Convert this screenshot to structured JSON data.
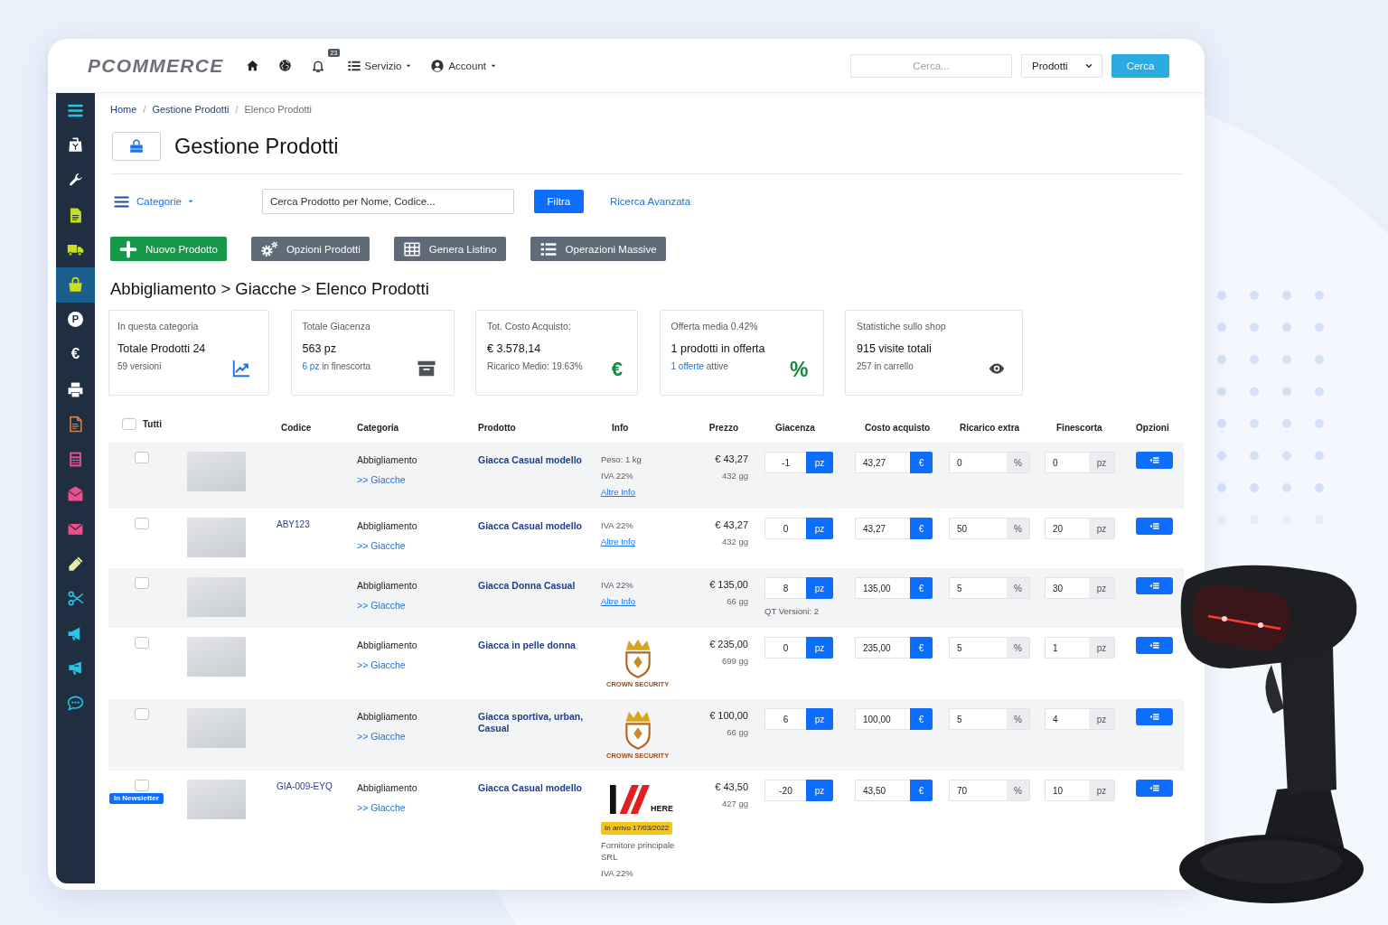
{
  "header": {
    "logo": "PCOMMERCE",
    "notification_count": "23",
    "menus": [
      {
        "label": "Servizio"
      },
      {
        "label": "Account"
      }
    ],
    "search": {
      "placeholder": "Cerca..."
    },
    "scope_select": {
      "value": "Prodotti"
    },
    "search_button": "Cerca"
  },
  "sidebar": {
    "items": [
      {
        "kind": "icon",
        "selected": false
      },
      {
        "kind": "icon",
        "selected": false
      },
      {
        "kind": "icon",
        "selected": false
      },
      {
        "kind": "icon",
        "selected": false
      },
      {
        "kind": "icon",
        "selected": false
      },
      {
        "kind": "icon",
        "selected": true
      },
      {
        "kind": "circle",
        "glyph": "P",
        "selected": false
      },
      {
        "kind": "glyph",
        "glyph": "€",
        "selected": false
      },
      {
        "kind": "icon",
        "selected": false
      },
      {
        "kind": "icon",
        "selected": false
      },
      {
        "kind": "icon",
        "selected": false
      },
      {
        "kind": "icon",
        "selected": false
      },
      {
        "kind": "icon",
        "selected": false
      },
      {
        "kind": "icon",
        "selected": false
      },
      {
        "kind": "icon",
        "selected": false
      },
      {
        "kind": "icon",
        "selected": false
      },
      {
        "kind": "icon",
        "selected": false
      },
      {
        "kind": "icon",
        "selected": false
      }
    ]
  },
  "breadcrumb": [
    {
      "kind": "link",
      "text": "Home"
    },
    {
      "kind": "separator",
      "text": "/"
    },
    {
      "kind": "link",
      "text": "Gestione Prodotti"
    },
    {
      "kind": "separator",
      "text": "/"
    },
    {
      "kind": "current",
      "text": "Elenco Prodotti"
    }
  ],
  "page_title": "Gestione Prodotti",
  "filter_bar": {
    "categories": "Categorie",
    "search": {
      "placeholder": "Cerca Prodotto per Nome, Codice..."
    },
    "filter_button": "Filtra",
    "advanced_search": "Ricerca Avanzata"
  },
  "actions": [
    {
      "kind": "primary",
      "label": "Nuovo Prodotto"
    },
    {
      "kind": "secondary",
      "label": "Opzioni Prodotti"
    },
    {
      "kind": "secondary",
      "label": "Genera Listino"
    },
    {
      "kind": "secondary",
      "label": "Operazioni Massive"
    }
  ],
  "category_path": "Abbigliamento > Giacche > Elenco Prodotti",
  "stats": [
    {
      "label": "In questa categoria",
      "value": "Totale Prodotti 24",
      "note": {
        "text": "59 versioni"
      }
    },
    {
      "label": "Totale Giacenza",
      "value": "563 pz",
      "note": {
        "link": "6 pz",
        "text": "in finescorta"
      }
    },
    {
      "label": "Tot. Costo Acquisto:",
      "value": "€ 3.578,14",
      "note": {
        "text": "Ricarico Medio: 19.63%"
      },
      "glyph": "€"
    },
    {
      "label": "Offerta media 0.42%",
      "value": "1 prodotti in offerta",
      "note": {
        "link": "1 offerte",
        "text": "attive"
      },
      "glyph": "%"
    },
    {
      "label": "Statistiche sullo shop",
      "value": "915 visite totali",
      "note": {
        "text": "257 in carrello"
      }
    }
  ],
  "table": {
    "select_all": {
      "label": "Tutti",
      "checked": false
    },
    "columns": [
      "Codice",
      "Categoria",
      "Prodotto",
      "Info",
      "Prezzo",
      "Giacenza",
      "Costo acquisto",
      "Ricarico extra",
      "Finescorta",
      "Opzioni"
    ],
    "rows": [
      {
        "checked": false,
        "category": "Abbigliamento",
        "subcategory": ">> Giacche",
        "product": "Giacca Casual modello",
        "info": [
          {
            "kind": "text",
            "text": "Peso: 1 kg"
          },
          {
            "kind": "text",
            "text": "IVA 22%"
          },
          {
            "kind": "link",
            "text": "Altre Info"
          }
        ],
        "price": "€ 43,27",
        "age": "432 gg",
        "stock": {
          "value": "-1",
          "unit": "pz"
        },
        "cost": {
          "value": "43,27",
          "unit": "€"
        },
        "markup": {
          "value": "0",
          "unit": "%"
        },
        "min_stock": {
          "value": "0",
          "unit": "pz"
        }
      },
      {
        "checked": false,
        "code": "ABY123",
        "category": "Abbigliamento",
        "subcategory": ">> Giacche",
        "product": "Giacca Casual modello",
        "info": [
          {
            "kind": "text",
            "text": "IVA 22%"
          },
          {
            "kind": "link",
            "text": "Altre Info"
          }
        ],
        "price": "€ 43,27",
        "age": "432 gg",
        "stock": {
          "value": "0",
          "unit": "pz"
        },
        "cost": {
          "value": "43,27",
          "unit": "€"
        },
        "markup": {
          "value": "50",
          "unit": "%"
        },
        "min_stock": {
          "value": "20",
          "unit": "pz"
        }
      },
      {
        "checked": false,
        "category": "Abbigliamento",
        "subcategory": ">> Giacche",
        "product": "Giacca Donna Casual",
        "info": [
          {
            "kind": "text",
            "text": "IVA 22%"
          },
          {
            "kind": "link",
            "text": "Altre Info"
          }
        ],
        "price": "€ 135,00",
        "age": "66 gg",
        "stock": {
          "value": "8",
          "unit": "pz"
        },
        "versions": "QT Versioni: 2",
        "cost": {
          "value": "135,00",
          "unit": "€"
        },
        "markup": {
          "value": "5",
          "unit": "%"
        },
        "min_stock": {
          "value": "30",
          "unit": "pz"
        }
      },
      {
        "checked": false,
        "category": "Abbigliamento",
        "subcategory": ">> Giacche",
        "product": "Giacca in pelle donna",
        "info": [
          {
            "kind": "crest",
            "text": "CROWN SECURITY"
          }
        ],
        "price": "€ 235,00",
        "age": "699 gg",
        "stock": {
          "value": "0",
          "unit": "pz"
        },
        "cost": {
          "value": "235,00",
          "unit": "€"
        },
        "markup": {
          "value": "5",
          "unit": "%"
        },
        "min_stock": {
          "value": "1",
          "unit": "pz"
        }
      },
      {
        "checked": false,
        "category": "Abbigliamento",
        "subcategory": ">> Giacche",
        "product": "Giacca sportiva, urban, Casual",
        "info": [
          {
            "kind": "crest",
            "text": "CROWN SECURITY"
          }
        ],
        "price": "€ 100,00",
        "age": "66 gg",
        "stock": {
          "value": "6",
          "unit": "pz"
        },
        "cost": {
          "value": "100,00",
          "unit": "€"
        },
        "markup": {
          "value": "5",
          "unit": "%"
        },
        "min_stock": {
          "value": "4",
          "unit": "pz"
        }
      },
      {
        "checked": false,
        "badge": "In Newsletter",
        "code": "GIA-009-EYQ",
        "category": "Abbigliamento",
        "subcategory": ">> Giacche",
        "product": "Giacca Casual modello",
        "info": [
          {
            "kind": "stripes",
            "text": "HERE"
          },
          {
            "kind": "badge",
            "text": "In arrivo 17/03/2022"
          },
          {
            "kind": "text",
            "text": "Fornitore principale SRL"
          },
          {
            "kind": "text",
            "text": "IVA 22%"
          }
        ],
        "price": "€ 43,50",
        "age": "427 gg",
        "stock": {
          "value": "-20",
          "unit": "pz"
        },
        "cost": {
          "value": "43,50",
          "unit": "€"
        },
        "markup": {
          "value": "70",
          "unit": "%"
        },
        "min_stock": {
          "value": "10",
          "unit": "pz"
        }
      }
    ]
  }
}
